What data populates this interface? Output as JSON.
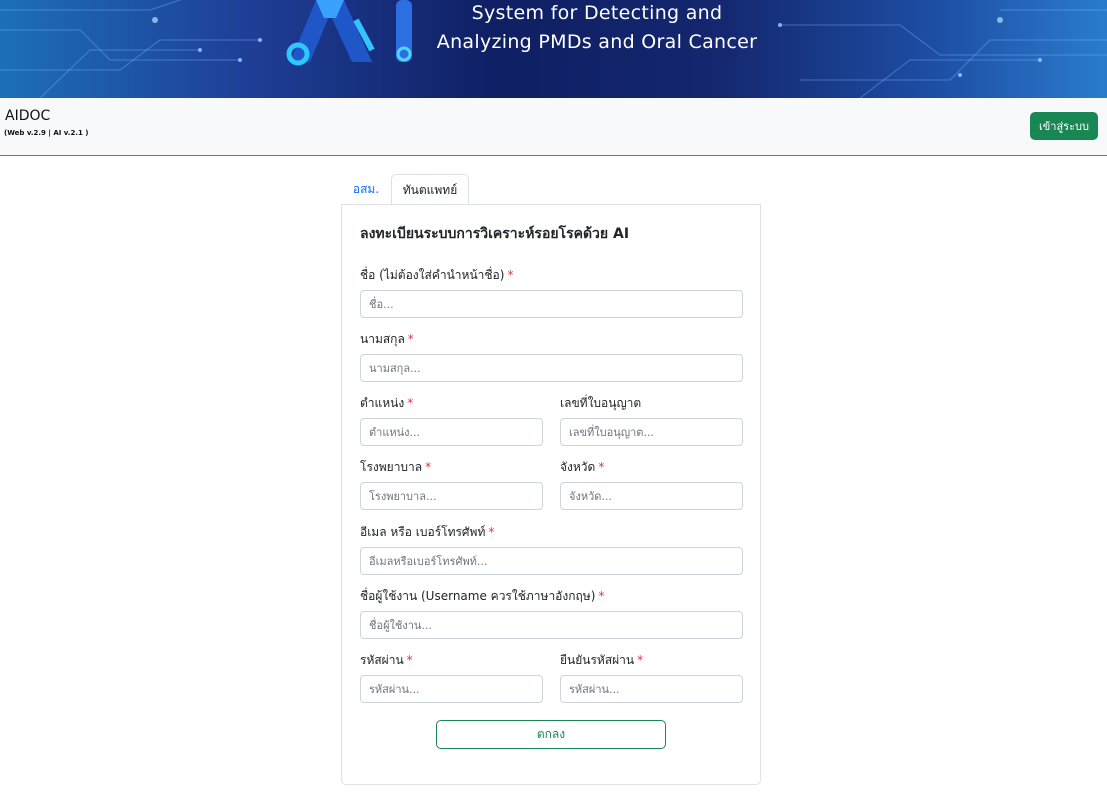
{
  "banner": {
    "title_line1": "System for Detecting and",
    "title_line2": "Analyzing PMDs and Oral Cancer"
  },
  "navbar": {
    "brand": "AIDOC",
    "version": "(Web v.2.9 | AI v.2.1 )",
    "login_label": "เข้าสู่ระบบ"
  },
  "tabs": [
    {
      "label": "อสม."
    },
    {
      "label": "ทันตแพทย์",
      "active": true
    }
  ],
  "form": {
    "title": "ลงทะเบียนระบบการวิเคราะห์รอยโรคด้วย AI",
    "required_mark": "*",
    "fields": {
      "first_name": {
        "label": "ชื่อ (ไม่ต้องใส่คำนำหน้าชื่อ)",
        "placeholder": "ชื่อ..."
      },
      "last_name": {
        "label": "นามสกุล",
        "placeholder": "นามสกุล..."
      },
      "position": {
        "label": "ตำแหน่ง",
        "placeholder": "ตำแหน่ง..."
      },
      "license": {
        "label": "เลขที่ใบอนุญาต",
        "placeholder": "เลขที่ใบอนุญาต..."
      },
      "hospital": {
        "label": "โรงพยาบาล",
        "placeholder": "โรงพยาบาล..."
      },
      "province": {
        "label": "จังหวัด",
        "placeholder": "จังหวัด..."
      },
      "contact": {
        "label": "อีเมล หรือ เบอร์โทรศัพท์",
        "placeholder": "อีเมลหรือเบอร์โทรศัพท์..."
      },
      "username": {
        "label": "ชื่อผู้ใช้งาน (Username ควรใช้ภาษาอังกฤษ)",
        "placeholder": "ชื่อผู้ใช้งาน..."
      },
      "password": {
        "label": "รหัสผ่าน",
        "placeholder": "รหัสผ่าน..."
      },
      "confirm_password": {
        "label": "ยืนยันรหัสผ่าน",
        "placeholder": "รหัสผ่าน..."
      }
    },
    "submit_label": "ตกลง"
  },
  "colors": {
    "accent_green": "#198754",
    "link_blue": "#0d6efd",
    "required_red": "#dc3545",
    "banner_navy": "#14276f"
  },
  "icons": [
    "ai-logo-icon"
  ]
}
